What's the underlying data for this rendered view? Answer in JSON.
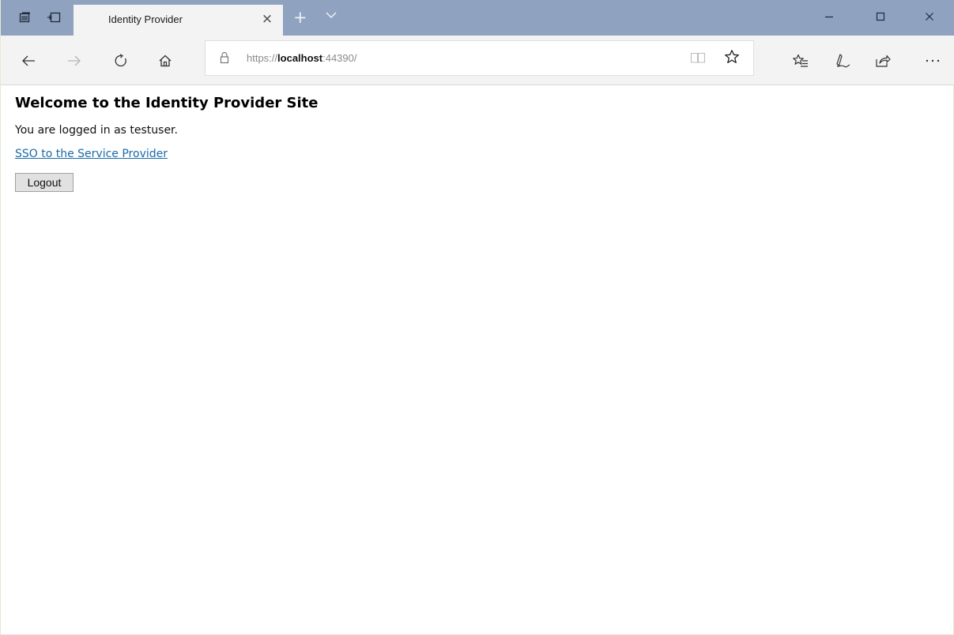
{
  "browser": {
    "tab": {
      "title": "Identity Provider",
      "close_glyph": "×"
    },
    "new_tab_glyph": "+",
    "address_bar": {
      "scheme": "https://",
      "host": "localhost",
      "port_path": ":44390/"
    },
    "colors": {
      "tabstrip": "#8fa2bf",
      "tab_active": "#f3f3f3",
      "toolbar": "#f3f3f3",
      "link": "#1a6aa9"
    },
    "icons": [
      "set-tabs-aside-icon",
      "restore-tabs-icon",
      "back-icon",
      "forward-icon",
      "refresh-icon",
      "home-icon",
      "lock-icon",
      "reading-view-icon",
      "favorite-star-icon",
      "favorites-hub-icon",
      "notes-pen-icon",
      "share-icon",
      "more-icon",
      "minimize-icon",
      "maximize-icon",
      "close-icon"
    ]
  },
  "page": {
    "heading": "Welcome to the Identity Provider Site",
    "status_text": "You are logged in as testuser.",
    "sso_link": "SSO to the Service Provider",
    "logout_button": "Logout"
  }
}
